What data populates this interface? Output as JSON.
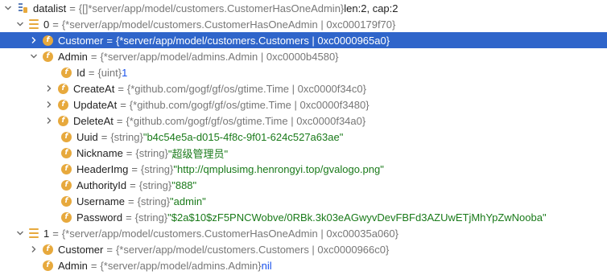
{
  "rows": [
    {
      "key": "datalist",
      "type": "{[]*server/app/model/customers.CustomerHasOneAdmin}",
      "value": " len:2, cap:2"
    },
    {
      "key": "0",
      "type": "{*server/app/model/customers.CustomerHasOneAdmin | 0xc000179f70}",
      "value": ""
    },
    {
      "key": "Customer",
      "type": "{*server/app/model/customers.Customers | 0xc0000965a0}",
      "value": ""
    },
    {
      "key": "Admin",
      "type": "{*server/app/model/admins.Admin | 0xc0000b4580}",
      "value": ""
    },
    {
      "key": "Id",
      "type": "{uint}",
      "value": " 1"
    },
    {
      "key": "CreateAt",
      "type": "{*github.com/gogf/gf/os/gtime.Time | 0xc0000f34c0}",
      "value": ""
    },
    {
      "key": "UpdateAt",
      "type": "{*github.com/gogf/gf/os/gtime.Time | 0xc0000f3480}",
      "value": ""
    },
    {
      "key": "DeleteAt",
      "type": "{*github.com/gogf/gf/os/gtime.Time | 0xc0000f34a0}",
      "value": ""
    },
    {
      "key": "Uuid",
      "type": "{string}",
      "value": " \"b4c54e5a-d015-4f8c-9f01-624c527a63ae\""
    },
    {
      "key": "Nickname",
      "type": "{string}",
      "value": " \"超级管理员\""
    },
    {
      "key": "HeaderImg",
      "type": "{string}",
      "value": " \"http://qmplusimg.henrongyi.top/gvalogo.png\""
    },
    {
      "key": "AuthorityId",
      "type": "{string}",
      "value": " \"888\""
    },
    {
      "key": "Username",
      "type": "{string}",
      "value": " \"admin\""
    },
    {
      "key": "Password",
      "type": "{string}",
      "value": " \"$2a$10$zF5PNCWobve/0RBk.3k03eAGwyvDevFBFd3AZUwETjMhYpZwNooba\""
    },
    {
      "key": "1",
      "type": "{*server/app/model/customers.CustomerHasOneAdmin | 0xc00035a060}",
      "value": ""
    },
    {
      "key": "Customer",
      "type": "{*server/app/model/customers.Customers | 0xc0000966c0}",
      "value": ""
    },
    {
      "key": "Admin",
      "type": "{*server/app/model/admins.Admin}",
      "value": " nil"
    }
  ],
  "equals": "=",
  "colors": {
    "selection": "#2f65ca",
    "field_badge": "#e7a93d",
    "string_value": "#1a7a1a",
    "number_value": "#1750eb"
  },
  "icons": {
    "expanded": "chevron-down-icon",
    "collapsed": "chevron-right-icon",
    "field": "field-badge-icon",
    "list": "list-element-icon",
    "root": "variable-root-icon"
  }
}
